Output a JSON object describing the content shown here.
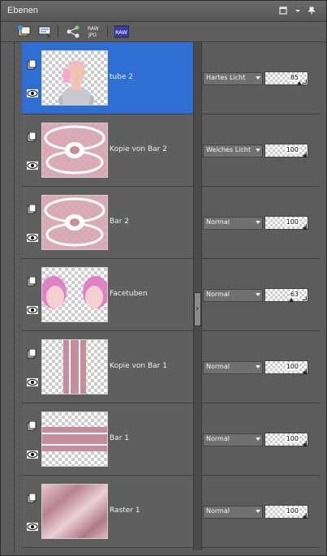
{
  "panel": {
    "title": "Ebenen"
  },
  "titlebar_icons": [
    "maximize-icon",
    "dropdown-icon",
    "pin-icon"
  ],
  "toolbar": {
    "tools": [
      "new-layer-icon",
      "layer-properties-icon",
      "share-icon",
      "raw-jpg-icon",
      "raw-icon"
    ]
  },
  "layers": [
    {
      "name": "tube 2",
      "blend": "Hartes Licht",
      "opacity": "85",
      "selected": true,
      "thumb": "woman"
    },
    {
      "name": "Kopie von Bar 2",
      "blend": "Weiches Licht",
      "opacity": "100",
      "selected": false,
      "thumb": "bar2"
    },
    {
      "name": "Bar 2",
      "blend": "Normal",
      "opacity": "100",
      "selected": false,
      "thumb": "bar2"
    },
    {
      "name": "Facetuben",
      "blend": "Normal",
      "opacity": "63",
      "selected": false,
      "thumb": "faces"
    },
    {
      "name": "Kopie von Bar 1",
      "blend": "Normal",
      "opacity": "100",
      "selected": false,
      "thumb": "bar1v"
    },
    {
      "name": "Bar 1",
      "blend": "Normal",
      "opacity": "100",
      "selected": false,
      "thumb": "bar1h"
    },
    {
      "name": "Raster 1",
      "blend": "Normal",
      "opacity": "100",
      "selected": false,
      "thumb": "raster"
    }
  ]
}
